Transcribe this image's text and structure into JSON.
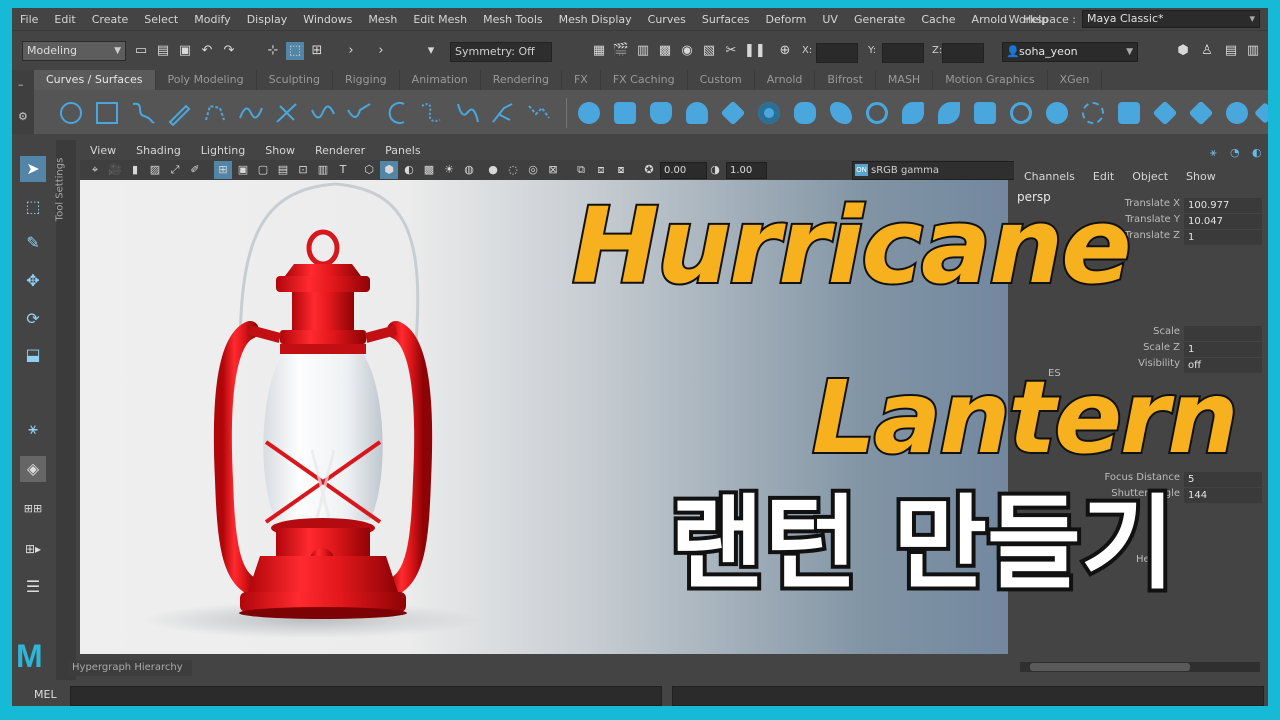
{
  "menubar": {
    "items": [
      "File",
      "Edit",
      "Create",
      "Select",
      "Modify",
      "Display",
      "Windows",
      "Mesh",
      "Edit Mesh",
      "Mesh Tools",
      "Mesh Display",
      "Curves",
      "Surfaces",
      "Deform",
      "UV",
      "Generate",
      "Cache",
      "Arnold",
      "Help"
    ],
    "workspace_label": "Workspace :",
    "workspace_value": "Maya Classic*"
  },
  "statusline": {
    "mode": "Modeling",
    "symmetry": "Symmetry: Off",
    "x_label": "X:",
    "y_label": "Y:",
    "z_label": "Z:",
    "user": "soha_yeon"
  },
  "shelf": {
    "tabs": [
      "Curves / Surfaces",
      "Poly Modeling",
      "Sculpting",
      "Rigging",
      "Animation",
      "Rendering",
      "FX",
      "FX Caching",
      "Custom",
      "Arnold",
      "Bifrost",
      "MASH",
      "Motion Graphics",
      "XGen"
    ],
    "active_tab": "Curves / Surfaces"
  },
  "left_panel": {
    "tool_settings_label": "Tool Settings"
  },
  "viewport": {
    "menu": [
      "View",
      "Shading",
      "Lighting",
      "Show",
      "Renderer",
      "Panels"
    ],
    "exposure": "0.00",
    "gamma": "1.00",
    "color_space": "sRGB gamma",
    "on_badge": "ON"
  },
  "channel_box": {
    "menu": [
      "Channels",
      "Edit",
      "Object",
      "Show"
    ],
    "object": "persp",
    "rows_top": [
      {
        "label": "Translate X",
        "value": "100.977"
      },
      {
        "label": "Translate Y",
        "value": "10.047"
      },
      {
        "label": "Translate Z",
        "value": "1"
      }
    ],
    "rows_mid": [
      {
        "label": "Scale",
        "value": ""
      },
      {
        "label": "Scale Z",
        "value": "1"
      },
      {
        "label": "Visibility",
        "value": "off"
      }
    ],
    "shapes_label": "ES",
    "rows_bottom": [
      {
        "label": "Focus Distance",
        "value": "5"
      },
      {
        "label": "Shutter Angle",
        "value": "144"
      }
    ],
    "help_fragment": "Help"
  },
  "bottom": {
    "hypergraph_tab": "Hypergraph Hierarchy",
    "mel_label": "MEL"
  },
  "logo_text": "M",
  "overlay": {
    "line1": "Hurricane",
    "line2": "Lantern",
    "line3": "랜턴 만들기"
  },
  "colors": {
    "accent_blue": "#5285a6",
    "frame_cyan": "#16b9d6",
    "title_yellow": "#f7b11f",
    "lantern_red": "#e3181c"
  }
}
